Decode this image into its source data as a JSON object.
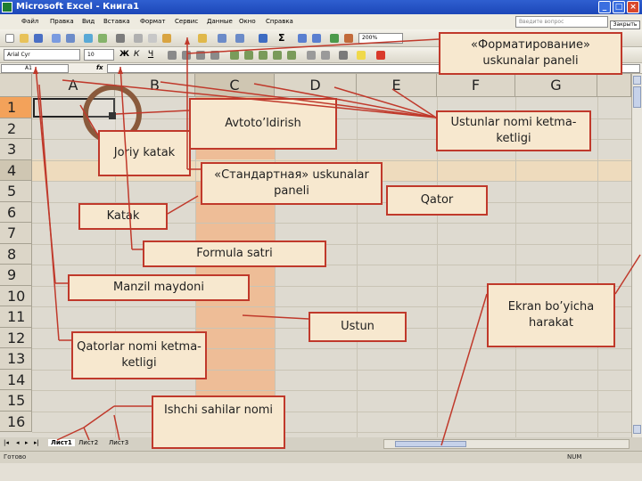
{
  "window": {
    "title": "Microsoft Excel - Книга1",
    "close_label": "Закрыть"
  },
  "menu": [
    "Файл",
    "Правка",
    "Вид",
    "Вставка",
    "Формат",
    "Сервис",
    "Данные",
    "Окно",
    "Справка"
  ],
  "help_placeholder": "Введите вопрос",
  "toolbar": {
    "font": "Arial Cyr",
    "size": "10",
    "zoom": "200%"
  },
  "formula_bar": {
    "cell_ref": "A1",
    "fx": "fx"
  },
  "columns": [
    "A",
    "B",
    "C",
    "D",
    "E",
    "F",
    "G"
  ],
  "rows": [
    "1",
    "2",
    "3",
    "4",
    "5",
    "6",
    "7",
    "8",
    "9",
    "10",
    "11",
    "12",
    "13",
    "14",
    "15",
    "16"
  ],
  "sheets": [
    "Лист1",
    "Лист2",
    "Лист3"
  ],
  "status": {
    "ready": "Готово",
    "num": "NUM"
  },
  "labels": {
    "formatting_toolbar": "«Форматирование» uskunalar paneli",
    "autofill": "Avtoto’ldirish",
    "column_names": "Ustunlar nomi ketma-ketligi",
    "active_cell": "Joriy katak",
    "standard_toolbar": "«Стандартная» uskunalar paneli",
    "row": "Qator",
    "cell": "Katak",
    "formula_bar": "Formula satri",
    "address_field": "Manzil maydoni",
    "screen_scroll": "Ekran bo’yicha harakat",
    "column": "Ustun",
    "row_names": "Qatorlar nomi ketma-ketligi",
    "sheet_names": "Ishchi sahilar nomi"
  },
  "colors": {
    "callout_border": "#c0392b",
    "callout_fill": "#f7e8cf",
    "highlight": "#eebd97"
  }
}
